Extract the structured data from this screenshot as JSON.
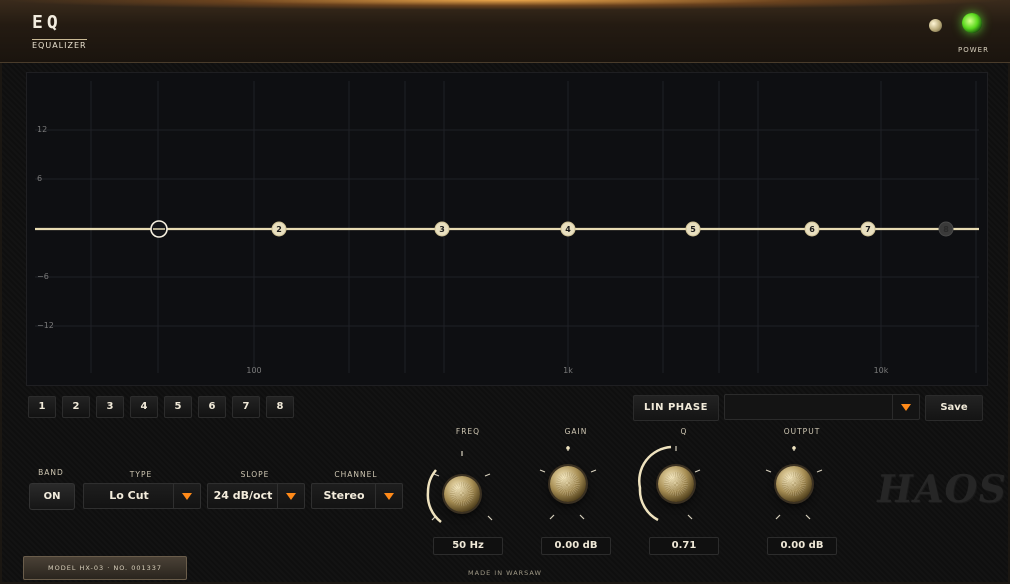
{
  "header": {
    "title": "EQ",
    "subtitle": "EQUALIZER",
    "power_label": "POWER"
  },
  "graph": {
    "y_ticks": [
      "12",
      "6",
      "",
      "−6",
      "−12"
    ],
    "x_ticks": [
      "100",
      "1k",
      "10k"
    ],
    "bands": [
      {
        "label": "",
        "selected": true
      },
      {
        "label": "2"
      },
      {
        "label": "3"
      },
      {
        "label": "4"
      },
      {
        "label": "5"
      },
      {
        "label": "6"
      },
      {
        "label": "7"
      },
      {
        "label": "8",
        "disabled": true
      }
    ]
  },
  "band_buttons": [
    "1",
    "2",
    "3",
    "4",
    "5",
    "6",
    "7",
    "8"
  ],
  "toolbar": {
    "lin_phase_label": "LIN PHASE",
    "preset_value": "",
    "save_label": "Save"
  },
  "controls": {
    "band_caption": "BAND",
    "band_toggle": "ON",
    "type_caption": "TYPE",
    "type_value": "Lo Cut",
    "slope_caption": "SLOPE",
    "slope_value": "24 dB/oct",
    "channel_caption": "CHANNEL",
    "channel_value": "Stereo",
    "freq_caption": "FREQ",
    "freq_value": "50 Hz",
    "gain_caption": "GAIN",
    "gain_value": "0.00 dB",
    "q_caption": "Q",
    "q_value": "0.71",
    "output_caption": "OUTPUT",
    "output_value": "0.00 dB"
  },
  "brand_logo": "HAOS",
  "footer": {
    "model_plate": "MODEL HX-03  ·  NO. 001337",
    "made_in": "MADE IN WARSAW"
  },
  "colors": {
    "accent_orange": "#ff8a19",
    "curve": "#e8dcb3",
    "power_led": "#59d81c"
  }
}
